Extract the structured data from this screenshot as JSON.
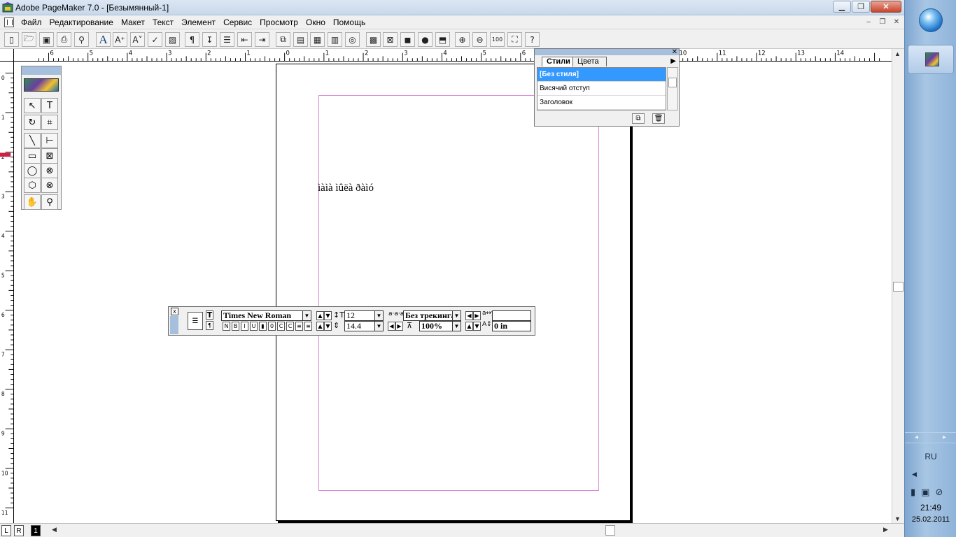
{
  "window": {
    "title": "Adobe PageMaker 7.0 - [Безымянный-1]",
    "minimize": "▁",
    "maximize": "❐",
    "close": "✕"
  },
  "menu": {
    "items": [
      "Файл",
      "Редактирование",
      "Макет",
      "Текст",
      "Элемент",
      "Сервис",
      "Просмотр",
      "Окно",
      "Помощь"
    ],
    "mdi_min": "–",
    "mdi_restore": "❐",
    "mdi_close": "✕"
  },
  "toolbar": {
    "buttons": [
      {
        "icon": "new-document-icon",
        "glyph": "▯"
      },
      {
        "icon": "open-folder-icon",
        "glyph": "🗁"
      },
      {
        "icon": "save-icon",
        "glyph": "▣"
      },
      {
        "icon": "print-icon",
        "glyph": "⎙"
      },
      {
        "icon": "find-binoculars-icon",
        "glyph": "⚲"
      },
      {
        "icon": "font-icon",
        "glyph": "A"
      },
      {
        "icon": "font-size-up-icon",
        "glyph": "A⁺"
      },
      {
        "icon": "font-size-down-icon",
        "glyph": "A˅"
      },
      {
        "icon": "spell-check-icon",
        "glyph": "✓"
      },
      {
        "icon": "fill-icon",
        "glyph": "▨"
      },
      {
        "icon": "paragraph-icon",
        "glyph": "¶"
      },
      {
        "icon": "indents-tabs-icon",
        "glyph": "↧"
      },
      {
        "icon": "bullets-icon",
        "glyph": "☰"
      },
      {
        "icon": "decrease-indent-icon",
        "glyph": "⇤"
      },
      {
        "icon": "increase-indent-icon",
        "glyph": "⇥"
      },
      {
        "icon": "copy-icon",
        "glyph": "⧉"
      },
      {
        "icon": "paste-icon",
        "glyph": "▤"
      },
      {
        "icon": "story-editor-icon",
        "glyph": "▦"
      },
      {
        "icon": "text-wrap-icon",
        "glyph": "▥"
      },
      {
        "icon": "link-icon",
        "glyph": "◎"
      },
      {
        "icon": "place-image-icon",
        "glyph": "▩"
      },
      {
        "icon": "export-icon",
        "glyph": "⊠"
      },
      {
        "icon": "image-icon",
        "glyph": "◼"
      },
      {
        "icon": "html-globe-icon",
        "glyph": "●"
      },
      {
        "icon": "pdf-icon",
        "glyph": "⬒"
      },
      {
        "icon": "zoom-in-icon",
        "glyph": "⊕"
      },
      {
        "icon": "zoom-out-icon",
        "glyph": "⊖"
      },
      {
        "icon": "actual-size-icon",
        "glyph": "100"
      },
      {
        "icon": "fit-window-icon",
        "glyph": "⛶"
      },
      {
        "icon": "help-icon",
        "glyph": "?"
      }
    ]
  },
  "rulers": {
    "horizontal_labels": [
      "6",
      "5",
      "4",
      "3",
      "2",
      "1",
      "0",
      "1",
      "2",
      "3",
      "4",
      "5",
      "6",
      "7",
      "8",
      "9",
      "10",
      "11",
      "12",
      "13",
      "14"
    ],
    "vertical_labels": [
      "0",
      "1",
      "2",
      "3",
      "4",
      "5",
      "6",
      "7",
      "8",
      "9",
      "10",
      "11"
    ]
  },
  "page": {
    "text": "ìàìà ìûëà ðàìó"
  },
  "toolbox": {
    "tools": [
      {
        "name": "pointer-tool",
        "glyph": "↖"
      },
      {
        "name": "text-tool",
        "glyph": "T"
      },
      {
        "name": "rotate-tool",
        "glyph": "↻"
      },
      {
        "name": "crop-tool",
        "glyph": "⌗"
      },
      {
        "name": "line-tool",
        "glyph": "╲"
      },
      {
        "name": "constrained-line-tool",
        "glyph": "⊢"
      },
      {
        "name": "rectangle-tool",
        "glyph": "▭"
      },
      {
        "name": "rectangle-frame-tool",
        "glyph": "⊠"
      },
      {
        "name": "ellipse-tool",
        "glyph": "◯"
      },
      {
        "name": "ellipse-frame-tool",
        "glyph": "⊗"
      },
      {
        "name": "polygon-tool",
        "glyph": "⬡"
      },
      {
        "name": "polygon-frame-tool",
        "glyph": "⊗"
      },
      {
        "name": "hand-tool",
        "glyph": "✋"
      },
      {
        "name": "zoom-tool",
        "glyph": "⚲"
      }
    ]
  },
  "styles_palette": {
    "tabs": [
      "Стили",
      "Цвета"
    ],
    "styles": [
      "[Без стиля]",
      "Висячий отступ",
      "Заголовок"
    ],
    "new_style_glyph": "⧉",
    "delete_glyph": "🗑",
    "menu_arrow": "▶"
  },
  "control_palette": {
    "close": "x",
    "font": "Times New Roman",
    "size": "12",
    "leading": "14.4",
    "tracking": "Без трекинга",
    "width": "100%",
    "kerning": "",
    "baseline_shift": "0 in",
    "style_buttons": [
      "N",
      "B",
      "I",
      "U",
      "▮",
      "0",
      "C",
      "C",
      "≡",
      "≡"
    ]
  },
  "pages": {
    "left": "L",
    "right": "R",
    "current": "1"
  },
  "taskbar": {
    "language": "RU",
    "time": "21:49",
    "date": "25.02.2011"
  }
}
